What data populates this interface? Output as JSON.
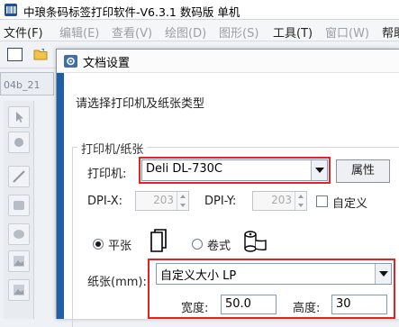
{
  "app": {
    "title": "中琅条码标签打印软件-V6.3.1 数码版 单机"
  },
  "menubar": {
    "items": [
      {
        "label": "文件(F)",
        "enabled": true
      },
      {
        "label": "编辑(E)",
        "enabled": false
      },
      {
        "label": "查看(V)",
        "enabled": false
      },
      {
        "label": "绘图(D)",
        "enabled": false
      },
      {
        "label": "图形(S)",
        "enabled": false
      },
      {
        "label": "工具(T)",
        "enabled": true
      },
      {
        "label": "窗口(W)",
        "enabled": false
      },
      {
        "label": "帮助",
        "enabled": true
      }
    ]
  },
  "doc_tab": {
    "label": "04b_21"
  },
  "dialog": {
    "title": "文档设置",
    "prompt": "请选择打印机及纸张类型",
    "group_label": "打印机/纸张",
    "printer": {
      "label": "打印机:",
      "value": "Deli DL-730C",
      "properties_button": "属性"
    },
    "dpi_x": {
      "label": "DPI-X:",
      "value": "203"
    },
    "dpi_y": {
      "label": "DPI-Y:",
      "value": "203"
    },
    "custom_checkbox": {
      "label": "自定义",
      "checked": false
    },
    "paper_type": {
      "flat": {
        "label": "平张",
        "selected": true
      },
      "roll": {
        "label": "卷式",
        "selected": false
      }
    },
    "paper": {
      "label": "纸张(mm):",
      "value": "自定义大小 LP"
    },
    "width": {
      "label": "宽度:",
      "value": "50.0"
    },
    "height": {
      "label": "高度:",
      "value": "30"
    }
  },
  "colors": {
    "highlight": "#e52222",
    "accent": "#1e5fa6"
  }
}
